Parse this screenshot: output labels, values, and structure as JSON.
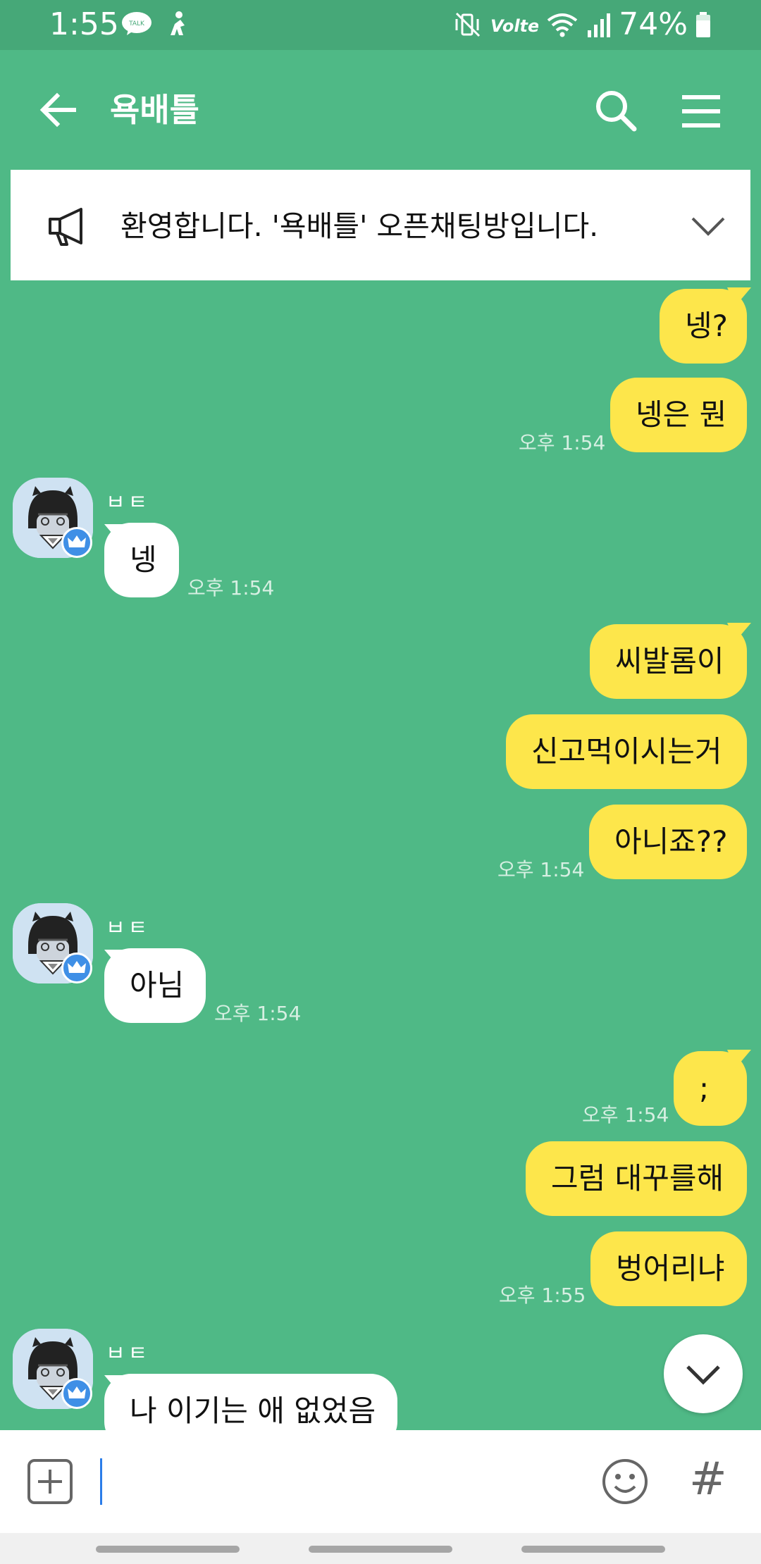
{
  "status_bar": {
    "time": "1:55",
    "talk_badge": "TALK",
    "network": "Volte",
    "battery_pct": "74%"
  },
  "header": {
    "title": "욕배틀",
    "back_icon": "back-arrow-icon",
    "search_icon": "search-icon",
    "menu_icon": "menu-icon"
  },
  "notice": {
    "text": "환영합니다. '욕배틀' 오픈채팅방입니다.",
    "icon": "megaphone-icon",
    "expand_icon": "chevron-down-icon"
  },
  "messages": [
    {
      "side": "me",
      "text": "넹?"
    },
    {
      "side": "me",
      "text": "넹은 뭔",
      "time": "오후 1:54"
    },
    {
      "side": "other",
      "sender": "ㅂㅌ",
      "text": "넹",
      "time": "오후 1:54"
    },
    {
      "side": "me",
      "text": "씨발롬이"
    },
    {
      "side": "me",
      "text": "신고먹이시는거"
    },
    {
      "side": "me",
      "text": "아니죠??",
      "time": "오후 1:54"
    },
    {
      "side": "other",
      "sender": "ㅂㅌ",
      "text": "아님",
      "time": "오후 1:54"
    },
    {
      "side": "me",
      "text": ";",
      "time": "오후 1:54"
    },
    {
      "side": "me",
      "text": "그럼 대꾸를해"
    },
    {
      "side": "me",
      "text": "벙어리냐",
      "time": "오후 1:55"
    },
    {
      "side": "other",
      "sender": "ㅂㅌ",
      "text": "나 이기는 애 없었음"
    }
  ],
  "input": {
    "value": "",
    "plus_icon": "plus-box-icon",
    "emoji_icon": "emoji-icon",
    "hash_label": "#"
  },
  "colors": {
    "background": "#4fb986",
    "my_bubble": "#fde64b",
    "other_bubble": "#ffffff",
    "status_bar": "#46a878"
  }
}
